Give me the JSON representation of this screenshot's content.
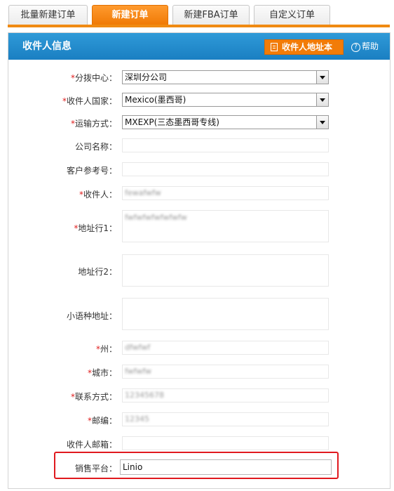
{
  "tabs": [
    {
      "label": "批量新建订单"
    },
    {
      "label": "新建订单"
    },
    {
      "label": "新建FBA订单"
    },
    {
      "label": "自定义订单"
    }
  ],
  "panel": {
    "title": "收件人信息",
    "address_book_button": "收件人地址本",
    "help": "帮助"
  },
  "form": {
    "distribution_center": {
      "label": "分拨中心：",
      "value": "深圳分公司"
    },
    "recipient_country": {
      "label": "收件人国家：",
      "value": "Mexico(墨西哥)"
    },
    "shipping_method": {
      "label": "运输方式：",
      "value": "MXEXP(三态墨西哥专线)"
    },
    "company_name": {
      "label": "公司名称：",
      "value": ""
    },
    "customer_reference": {
      "label": "客户参考号：",
      "value": ""
    },
    "recipient": {
      "label": "收件人：",
      "value": "fewafwfw"
    },
    "address_line1": {
      "label": "地址行1：",
      "value": "fwfwfwfwfwfwfw"
    },
    "address_line2": {
      "label": "地址行2：",
      "value": ""
    },
    "local_language_address": {
      "label": "小语种地址：",
      "value": ""
    },
    "state": {
      "label": "州：",
      "value": "dfwfwf"
    },
    "city": {
      "label": "城市：",
      "value": "fwfwfw"
    },
    "phone": {
      "label": "联系方式：",
      "value": "12345678"
    },
    "postcode": {
      "label": "邮编：",
      "value": "12345"
    },
    "email": {
      "label": "收件人邮箱：",
      "value": ""
    },
    "sales_platform": {
      "label": "销售平台：",
      "value": "Linio"
    }
  },
  "required_mark": "*",
  "colors": {
    "accent": "#f08a12",
    "header_blue": "#1a7fc2",
    "highlight_red": "#e0191e",
    "required_red": "#e02020"
  }
}
